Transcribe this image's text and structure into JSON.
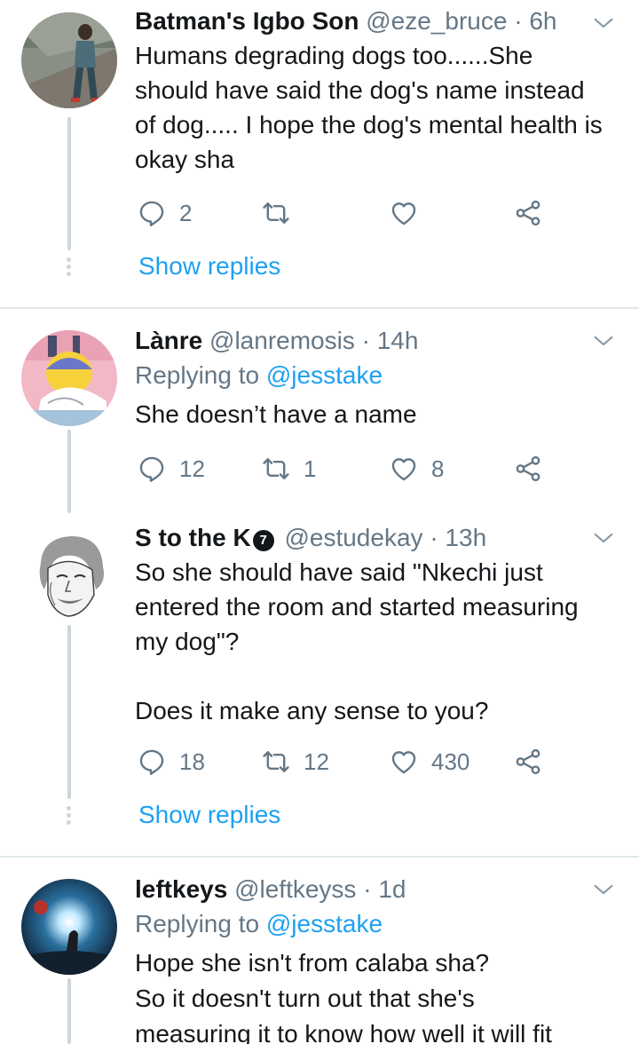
{
  "tweets": [
    {
      "name": "Batman's Igbo Son",
      "handle": "@eze_bruce",
      "sep": "·",
      "time": "6h",
      "replying_prefix": "",
      "replying_to": "",
      "text": "Humans degrading dogs too......She should have said the dog's name instead of dog..... I hope the dog's mental health is okay sha",
      "reply_count": "2",
      "retweet_count": "",
      "like_count": "",
      "show_replies": "Show replies"
    },
    {
      "name": "Lànre",
      "handle": "@lanremosis",
      "sep": "·",
      "time": "14h",
      "replying_prefix": "Replying to ",
      "replying_to": "@jesstake",
      "text": "She doesn’t have a name",
      "reply_count": "12",
      "retweet_count": "1",
      "like_count": "8"
    },
    {
      "name": "S to the K",
      "verified_glyph": "7",
      "handle": "@estudekay",
      "sep": "·",
      "time": "13h",
      "text": "So she should have said \"Nkechi just entered the room and started measuring my dog\"?\n\nDoes it make any sense to you?",
      "reply_count": "18",
      "retweet_count": "12",
      "like_count": "430",
      "show_replies": "Show replies"
    },
    {
      "name": "leftkeys",
      "handle": "@leftkeyss",
      "sep": "·",
      "time": "1d",
      "replying_prefix": "Replying to ",
      "replying_to": "@jesstake",
      "text": "Hope she isn't from calaba sha?\nSo it doesn't turn out that she's\nmeasuring it to know how well it will fit"
    }
  ],
  "icons": {
    "reply": "reply-icon",
    "retweet": "retweet-icon",
    "like": "like-icon",
    "share": "share-icon",
    "menu": "chevron-down-icon"
  },
  "colors": {
    "link": "#1da1f2",
    "secondary_text": "#657786",
    "thread_line": "#ccd6dd",
    "divider": "#e1e8ed"
  }
}
